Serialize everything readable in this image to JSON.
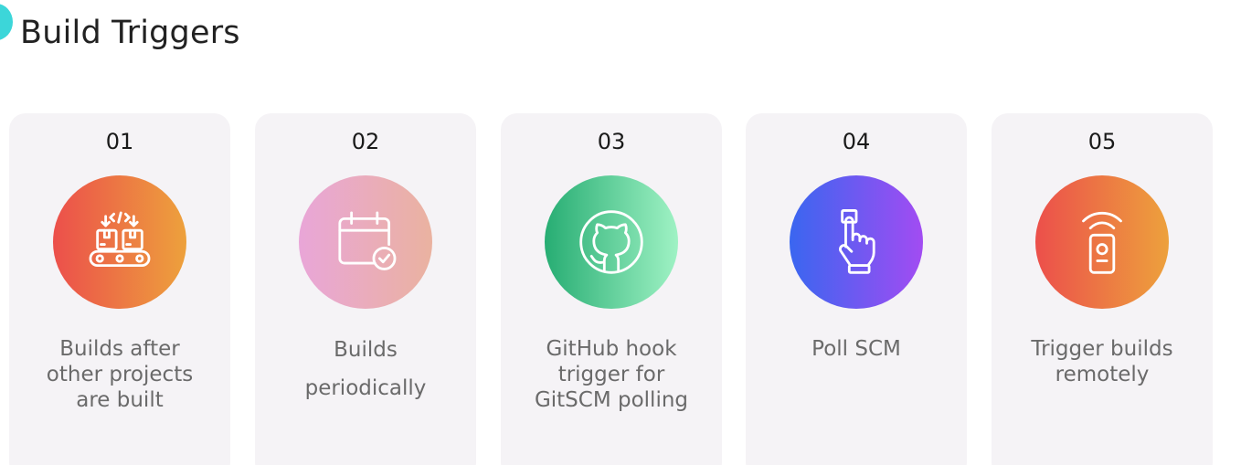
{
  "page": {
    "title": "Build Triggers",
    "accent": "#3cd6d9"
  },
  "cards": [
    {
      "number": "01",
      "label": "Builds after\nother projects\nare built",
      "icon": "conveyor-boxes-icon",
      "gradient": [
        "#ec4f4b",
        "#eda13c"
      ]
    },
    {
      "number": "02",
      "label": "Builds\nperiodically",
      "icon": "calendar-check-icon",
      "gradient": [
        "#e9a6d8",
        "#eab2a0"
      ]
    },
    {
      "number": "03",
      "label": "GitHub hook\ntrigger for\nGitSCM polling",
      "icon": "github-icon",
      "gradient": [
        "#27ad73",
        "#9ff2c4"
      ]
    },
    {
      "number": "04",
      "label": "Poll SCM",
      "icon": "hand-pointer-icon",
      "gradient": [
        "#3a66f0",
        "#a24cf2"
      ]
    },
    {
      "number": "05",
      "label": "Trigger builds\nremotely",
      "icon": "remote-signal-icon",
      "gradient": [
        "#ec4f4b",
        "#eda13c"
      ]
    }
  ]
}
